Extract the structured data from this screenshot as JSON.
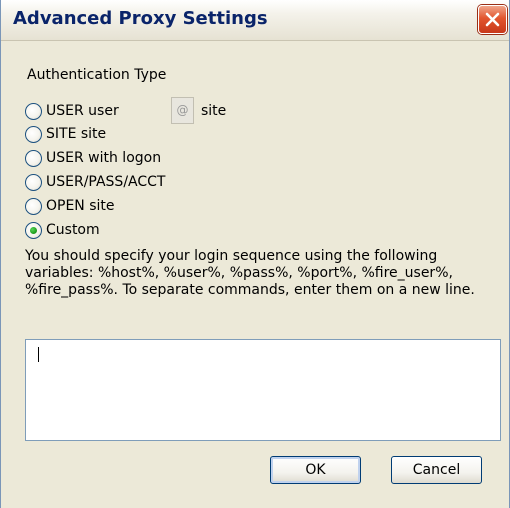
{
  "window": {
    "title": "Advanced Proxy Settings"
  },
  "auth": {
    "heading": "Authentication Type",
    "options": [
      {
        "label": "USER user",
        "selected": false
      },
      {
        "label": "SITE site",
        "selected": false
      },
      {
        "label": "USER with logon",
        "selected": false
      },
      {
        "label": "USER/PASS/ACCT",
        "selected": false
      },
      {
        "label": "OPEN site",
        "selected": false
      },
      {
        "label": "Custom",
        "selected": true
      }
    ],
    "at_symbol": "@",
    "site_suffix": "site"
  },
  "instructions": "You should specify your login sequence using the following variables: %host%, %user%, %pass%, %port%, %fire_user%, %fire_pass%. To separate commands, enter them on a new line.",
  "login_sequence": {
    "value": ""
  },
  "buttons": {
    "ok": "OK",
    "cancel": "Cancel"
  },
  "icons": {
    "close": "close-icon"
  },
  "colors": {
    "title_text": "#0a246a",
    "close_button": "#e2562f",
    "selected_radio": "#21a121"
  }
}
